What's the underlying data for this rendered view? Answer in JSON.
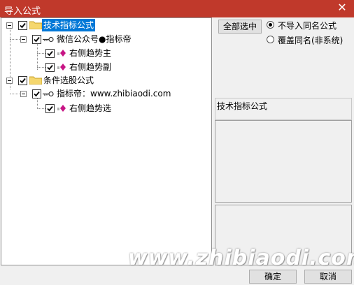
{
  "window": {
    "title": "导入公式",
    "close_glyph": "✕",
    "titlebar_color": "#c0392b"
  },
  "tree": {
    "nodes": [
      {
        "label": "技术指标公式",
        "checked": true,
        "selected": true,
        "icon": "folder-icon"
      },
      {
        "label": "微信公众号●指标帝",
        "checked": true,
        "icon": "key-icon"
      },
      {
        "label": "右侧趋势主",
        "checked": true,
        "icon": "formula-icon"
      },
      {
        "label": "右侧趋势副",
        "checked": true,
        "icon": "formula-icon"
      },
      {
        "label": "条件选股公式",
        "checked": true,
        "icon": "folder-icon"
      },
      {
        "label": "指标帝：www.zhibiaodi.com",
        "checked": true,
        "icon": "key-icon"
      },
      {
        "label": "右侧趋势选",
        "checked": true,
        "icon": "formula-icon"
      }
    ]
  },
  "options": {
    "select_all_label": "全部选中",
    "radio_no_import": "不导入同名公式",
    "radio_overwrite": "覆盖同名(非系统)",
    "selected_radio": "radio_no_import"
  },
  "detail": {
    "category_label": "技术指标公式"
  },
  "footer": {
    "ok_label": "确定",
    "cancel_label": "取消",
    "watermark": "www.zhibiaodi.com"
  }
}
